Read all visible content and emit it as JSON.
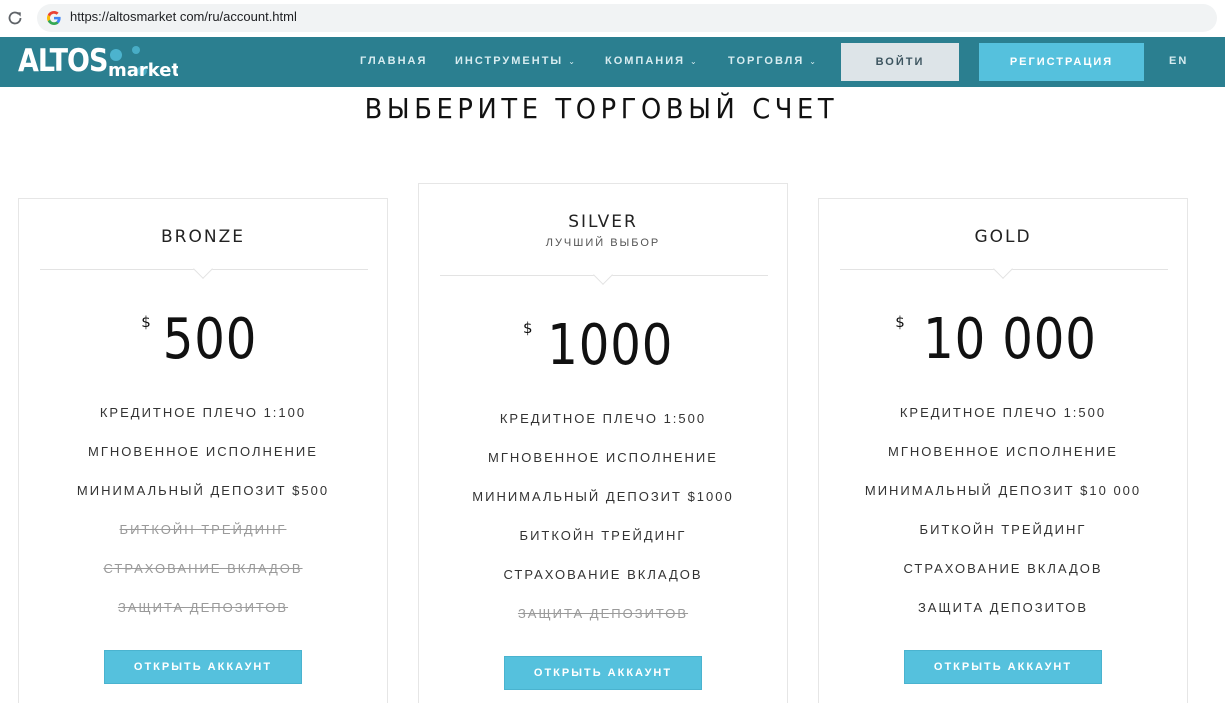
{
  "browser": {
    "url": "https://altosmarket com/ru/account.html"
  },
  "nav": {
    "logo_main": "ALTOS",
    "logo_sub": "market",
    "items": [
      {
        "label": "ГЛАВНАЯ",
        "has_dropdown": false
      },
      {
        "label": "ИНСТРУМЕНТЫ",
        "has_dropdown": true
      },
      {
        "label": "КОМПАНИЯ",
        "has_dropdown": true
      },
      {
        "label": "ТОРГОВЛЯ",
        "has_dropdown": true
      }
    ],
    "login_label": "ВОЙТИ",
    "register_label": "РЕГИСТРАЦИЯ",
    "lang_label": "EN",
    "chevron": "⌄"
  },
  "page": {
    "title": "ВЫБЕРИТЕ ТОРГОВЫЙ СЧЕТ"
  },
  "plans": [
    {
      "name": "BRONZE",
      "subtitle": "",
      "currency": "$",
      "amount": "500",
      "features": [
        {
          "text": "КРЕДИТНОЕ ПЛЕЧО 1:100",
          "included": true
        },
        {
          "text": "МГНОВЕННОЕ ИСПОЛНЕНИЕ",
          "included": true
        },
        {
          "text": "МИНИМАЛЬНЫЙ ДЕПОЗИТ $500",
          "included": true
        },
        {
          "text": "БИТКОЙН ТРЕЙДИНГ",
          "included": false
        },
        {
          "text": "СТРАХОВАНИЕ ВКЛАДОВ",
          "included": false
        },
        {
          "text": "ЗАЩИТА ДЕПОЗИТОВ",
          "included": false
        }
      ],
      "button_label": "ОТКРЫТЬ АККАУНТ"
    },
    {
      "name": "SILVER",
      "subtitle": "ЛУЧШИЙ ВЫБОР",
      "currency": "$",
      "amount": "1000",
      "features": [
        {
          "text": "КРЕДИТНОЕ ПЛЕЧО 1:500",
          "included": true
        },
        {
          "text": "МГНОВЕННОЕ ИСПОЛНЕНИЕ",
          "included": true
        },
        {
          "text": "МИНИМАЛЬНЫЙ ДЕПОЗИТ $1000",
          "included": true
        },
        {
          "text": "БИТКОЙН ТРЕЙДИНГ",
          "included": true
        },
        {
          "text": "СТРАХОВАНИЕ ВКЛАДОВ",
          "included": true
        },
        {
          "text": "ЗАЩИТА ДЕПОЗИТОВ",
          "included": false
        }
      ],
      "button_label": "ОТКРЫТЬ АККАУНТ"
    },
    {
      "name": "GOLD",
      "subtitle": "",
      "currency": "$",
      "amount": "10 000",
      "features": [
        {
          "text": "КРЕДИТНОЕ ПЛЕЧО 1:500",
          "included": true
        },
        {
          "text": "МГНОВЕННОЕ ИСПОЛНЕНИЕ",
          "included": true
        },
        {
          "text": "МИНИМАЛЬНЫЙ ДЕПОЗИТ $10 000",
          "included": true
        },
        {
          "text": "БИТКОЙН ТРЕЙДИНГ",
          "included": true
        },
        {
          "text": "СТРАХОВАНИЕ ВКЛАДОВ",
          "included": true
        },
        {
          "text": "ЗАЩИТА ДЕПОЗИТОВ",
          "included": true
        }
      ],
      "button_label": "ОТКРЫТЬ АККАУНТ"
    }
  ],
  "colors": {
    "nav_bg": "#2b7f90",
    "accent": "#55c1dd",
    "login_bg": "#dde4e8",
    "disabled_text": "#9a9a9a"
  },
  "icons": {
    "reload": "reload-icon",
    "google": "google-icon",
    "chevron": "chevron-down-icon"
  }
}
